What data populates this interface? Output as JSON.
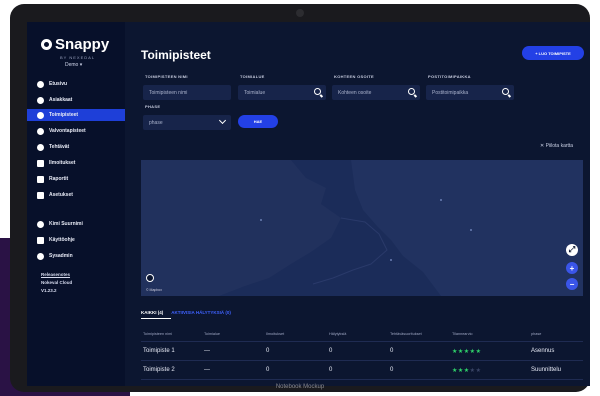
{
  "device": {
    "label": "Notebook Mockup"
  },
  "sidebar": {
    "brand": "Snappy",
    "brand_sub": "BY NEXEDAL",
    "account": "Demo ▾",
    "items": [
      {
        "label": "Etusivu",
        "icon": "home-icon"
      },
      {
        "label": "Asiakkaat",
        "icon": "users-icon"
      },
      {
        "label": "Toimipisteet",
        "icon": "location-icon",
        "active": true
      },
      {
        "label": "Valvontapisteet",
        "icon": "monitor-icon"
      },
      {
        "label": "Tehtävät",
        "icon": "clock-icon"
      },
      {
        "label": "Ilmoitukset",
        "icon": "bell-icon"
      },
      {
        "label": "Raportit",
        "icon": "chart-icon"
      },
      {
        "label": "Asetukset",
        "icon": "settings-icon"
      }
    ],
    "user_items": [
      {
        "label": "Kimi Suurnimi",
        "icon": "user-icon"
      },
      {
        "label": "Käyttöohje",
        "icon": "help-icon"
      },
      {
        "label": "Sysadmin",
        "icon": "gear-icon"
      }
    ],
    "footer": {
      "release_notes": "Releasenotes",
      "cloud": "Nokeval Cloud",
      "version": "V1.23.2"
    }
  },
  "main": {
    "title": "Toimipisteet",
    "new_button": "+ LUO TOIMIPISTE",
    "filters": {
      "name": {
        "label": "TOIMIPISTEEN NIMI",
        "placeholder": "Toimipisteen nimi"
      },
      "toimialue": {
        "label": "TOIMIALUE",
        "placeholder": "Toimialue"
      },
      "address": {
        "label": "KOHTEEN OSOITE",
        "placeholder": "Kohteen osoite"
      },
      "city": {
        "label": "POSTITOIMIPAIKKA",
        "placeholder": "Postitoimipaikka"
      },
      "phase": {
        "label": "PHASE",
        "value": "phase"
      }
    },
    "search_button": "HAE",
    "hide_map": "✕ Piilota kartta",
    "map": {
      "attribution": "© Mapbox"
    },
    "tabs": [
      {
        "label": "KAIKKI (4)"
      },
      {
        "label": "AKTIIVISIA HÄLYTYKSIÄ (0)"
      }
    ],
    "table": {
      "columns": [
        "Toimipisteen nimi",
        "Toimialue",
        "Ilmoitukset",
        "Hälytyksiä",
        "Tehtäväsuoritukset",
        "Tilannearvio",
        "phase"
      ],
      "rows": [
        {
          "name": "Toimipiste 1",
          "area": "—",
          "notices": "0",
          "alarms": "0",
          "tasks": "0",
          "rating": 5,
          "phase": "Asennus"
        },
        {
          "name": "Toimipiste 2",
          "area": "—",
          "notices": "0",
          "alarms": "0",
          "tasks": "0",
          "rating": 3,
          "phase": "Suunnittelu"
        }
      ]
    }
  },
  "colors": {
    "accent": "#2340e6",
    "star_on": "#2fd36a",
    "star_off": "#3a4566",
    "background": "#0c1630"
  }
}
